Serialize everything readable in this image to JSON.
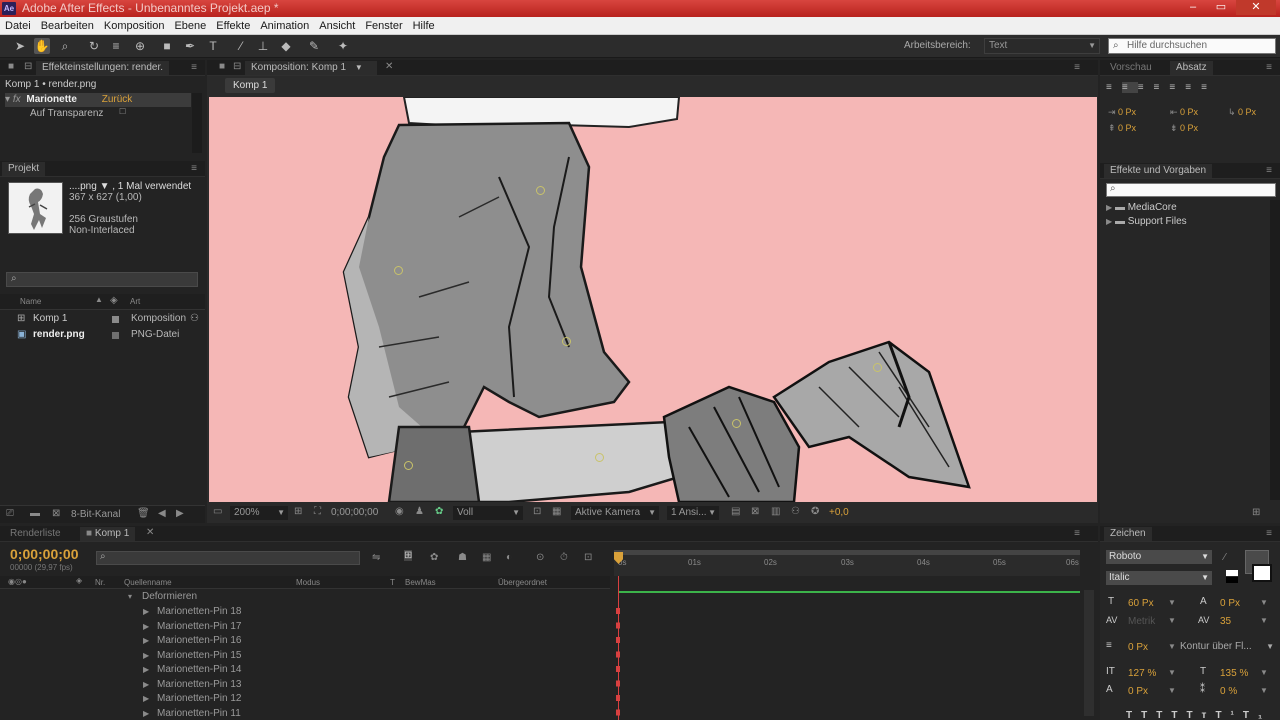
{
  "window": {
    "title": "Adobe After Effects - Unbenanntes Projekt.aep *"
  },
  "menu": [
    "Datei",
    "Bearbeiten",
    "Komposition",
    "Ebene",
    "Effekte",
    "Animation",
    "Ansicht",
    "Fenster",
    "Hilfe"
  ],
  "toolbar": {
    "workspace_label": "Arbeitsbereich:",
    "workspace_value": "Text",
    "help_placeholder": "Hilfe durchsuchen"
  },
  "effects_panel": {
    "tab": "Effekteinstellungen: render.",
    "breadcrumb": "Komp 1 • render.png",
    "effect_name": "Marionette",
    "reset_label": "Zurück",
    "prop_label": "Auf Transparenz"
  },
  "project_panel": {
    "tab": "Projekt",
    "file_name": "....png ▼ , 1 Mal verwendet",
    "file_dims": "367 x 627 (1,00)",
    "file_colors": "256 Graustufen",
    "file_interlace": "Non-Interlaced",
    "col_name": "Name",
    "col_type": "Art",
    "items": [
      {
        "name": "Komp 1",
        "type": "Komposition"
      },
      {
        "name": "render.png",
        "type": "PNG-Datei"
      }
    ],
    "bit_depth": "8-Bit-Kanal"
  },
  "comp_panel": {
    "tab": "Komposition: Komp 1",
    "subtab": "Komp 1",
    "zoom": "200%",
    "timecode": "0;00;00;00",
    "resolution": "Voll",
    "camera": "Aktive Kamera",
    "views": "1 Ansi...",
    "exposure": "+0,0"
  },
  "right_panel": {
    "tab_preview": "Vorschau",
    "tab_paragraph": "Absatz",
    "indent_values": [
      "0 Px",
      "0 Px",
      "0 Px",
      "0 Px",
      "0 Px"
    ],
    "effects_tab": "Effekte und Vorgaben",
    "folders": [
      "MediaCore",
      "Support Files"
    ]
  },
  "timeline": {
    "tab_render": "Renderliste",
    "tab_comp": "Komp 1",
    "timecode": "0;00;00;00",
    "fps": "00000 (29,97 fps)",
    "col_source": "Quellenname",
    "col_mode": "Modus",
    "col_trkmat": "BewMas",
    "col_parent": "Übergeordnet",
    "col_nr": "Nr.",
    "group": "Deformieren",
    "pins": [
      "Marionetten-Pin 18",
      "Marionetten-Pin 17",
      "Marionetten-Pin 16",
      "Marionetten-Pin 15",
      "Marionetten-Pin 14",
      "Marionetten-Pin 13",
      "Marionetten-Pin 12",
      "Marionetten-Pin 11"
    ],
    "ruler": [
      "0s",
      "01s",
      "02s",
      "03s",
      "04s",
      "05s",
      "06s"
    ]
  },
  "character_panel": {
    "tab": "Zeichen",
    "font": "Roboto",
    "style": "Italic",
    "size": "60 Px",
    "leading": "0 Px",
    "kerning": "Metrik",
    "tracking": "35",
    "stroke_width": "0 Px",
    "stroke_mode": "Kontur über Fl...",
    "v_scale": "127 %",
    "h_scale": "135 %",
    "baseline": "0 Px",
    "tsume": "0 %"
  },
  "colors": {
    "viewer_bg": "#f5b7b6",
    "accent": "#d9a13a",
    "titlebar": "#c8302b"
  }
}
